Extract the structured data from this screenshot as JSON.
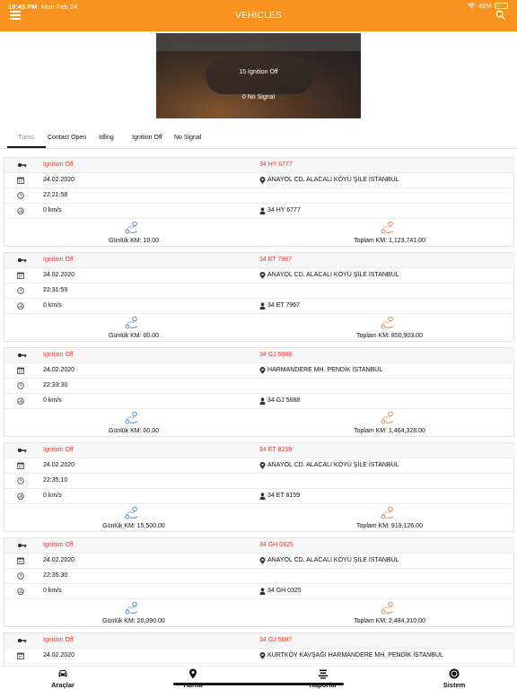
{
  "status_bar": {
    "time": "10:43 PM",
    "date": "Mon Feb 24",
    "battery": "45%",
    "battery_level": 0.45
  },
  "header": {
    "title": "VEHICLES"
  },
  "banner": {
    "line1": "15  Ignition Off",
    "line2": "0  No Signal"
  },
  "tabs": [
    {
      "label": "Tümü",
      "active": true
    },
    {
      "label": "Contact Open"
    },
    {
      "label": "Idling"
    },
    {
      "label": "Ignition Off"
    },
    {
      "label": "No Signal"
    }
  ],
  "colors": {
    "accent": "#f7931e",
    "status_red": "#e53935",
    "daily_icon": "#4a90e2",
    "total_icon": "#e8875a"
  },
  "vehicles": [
    {
      "status": "Ignition Off",
      "plate": "34 HY 6777",
      "date": "24.02.2020",
      "time": "22:21:58",
      "speed": "0 km/s",
      "address": "ANAYOL CD. ALACALI KÖYÜ ŞİLE İSTANBUL",
      "driver": "34 HY 6777",
      "daily": "Günlük KM: 10.00",
      "total": "Toplam KM: 1,123,741.00"
    },
    {
      "status": "Ignition Off",
      "plate": "34 ET 7967",
      "date": "24.02.2020",
      "time": "22:31:59",
      "speed": "0 km/s",
      "address": "ANAYOL CD. ALACALI KÖYÜ ŞİLE İSTANBUL",
      "driver": "34 ET 7967",
      "daily": "Günlük KM: 00.00",
      "total": "Toplam KM: 850,903.00"
    },
    {
      "status": "Ignition Off",
      "plate": "34 GJ 5688",
      "date": "24.02.2020",
      "time": "22:33:30",
      "speed": "0 km/s",
      "address": "HARMANDERE MH. PENDİK İSTANBUL",
      "driver": "34 GJ 5688",
      "daily": "Günlük KM: 00.00",
      "total": "Toplam KM: 1,464,328.00"
    },
    {
      "status": "Ignition Off",
      "plate": "34 ET 8159",
      "date": "24.02.2020",
      "time": "22:35:10",
      "speed": "0 km/s",
      "address": "ANAYOL CD. ALACALI KÖYÜ ŞİLE İSTANBUL",
      "driver": "34 ET 8159",
      "daily": "Günlük KM: 15,500.00",
      "total": "Toplam KM: 919,126.00"
    },
    {
      "status": "Ignition Off",
      "plate": "34 GH 0325",
      "date": "24.02.2020",
      "time": "22:35:30",
      "speed": "0 km/s",
      "address": "ANAYOL CD. ALACALI KÖYÜ ŞİLE İSTANBUL",
      "driver": "34 GH 0325",
      "daily": "Günlük KM: 20,090.00",
      "total": "Toplam KM: 2,484,310.00"
    },
    {
      "status": "Ignition Off",
      "plate": "34 GJ 5687",
      "date": "24.02.2020",
      "time": "",
      "speed": "",
      "address": "KURTKÖY KAVŞAĞI HARMANDERE MH. PENDİK İSTANBUL",
      "driver": "",
      "daily": "",
      "total": ""
    }
  ],
  "tabbar": [
    {
      "label": "Araçlar",
      "icon": "car-icon"
    },
    {
      "label": "Harita",
      "icon": "map-pin-icon"
    },
    {
      "label": "Raporlar",
      "icon": "reports-icon"
    },
    {
      "label": "Sistem",
      "icon": "system-icon"
    }
  ]
}
